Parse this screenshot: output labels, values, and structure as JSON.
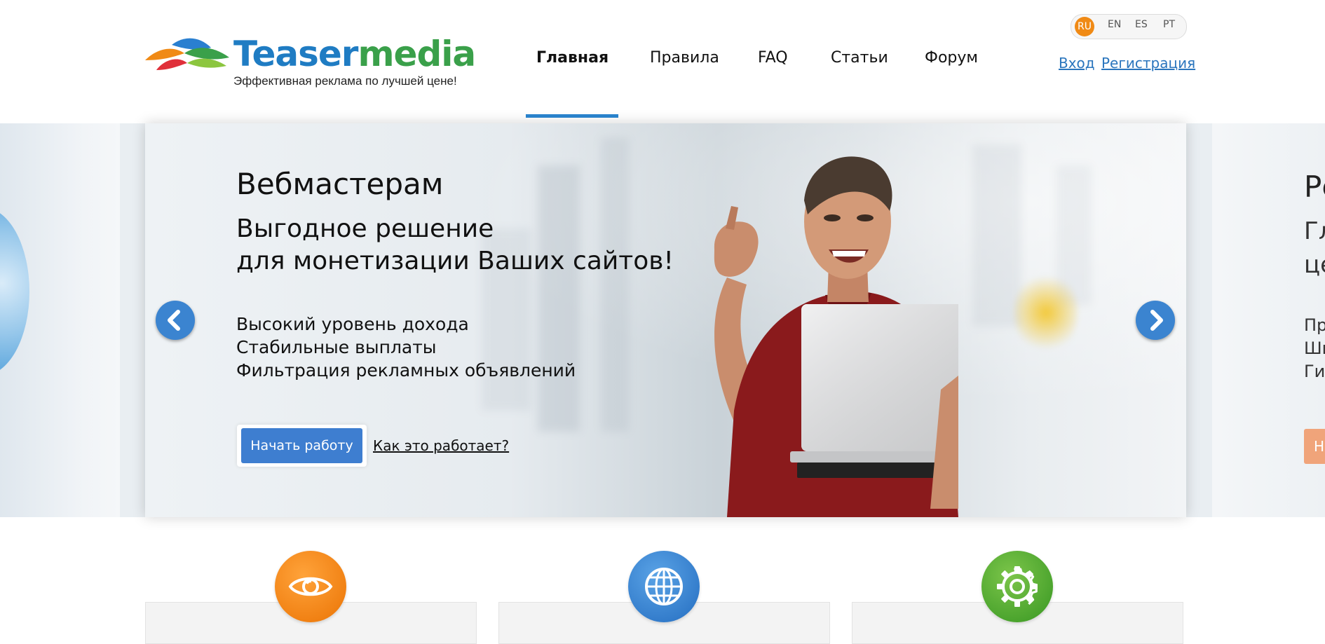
{
  "header": {
    "logo": {
      "word_part1": "Teaser",
      "word_part2": "media",
      "slogan": "Эффективная реклама по лучшей цене!"
    },
    "nav": [
      {
        "label": "Главная",
        "active": true
      },
      {
        "label": "Правила",
        "active": false
      },
      {
        "label": "FAQ",
        "active": false
      },
      {
        "label": "Статьи",
        "active": false
      },
      {
        "label": "Форум",
        "active": false
      }
    ],
    "languages": [
      "RU",
      "EN",
      "ES",
      "PT"
    ],
    "active_language": "RU",
    "auth": {
      "login": "Вход",
      "register": "Регистрация"
    },
    "accent_color": "#2a85d0"
  },
  "slider": {
    "current": {
      "title": "Вебмастерам",
      "subtitle_line1": "Выгодное решение",
      "subtitle_line2": "для монетизации Ваших сайтов!",
      "benefits": [
        "Высокий уровень дохода",
        "Стабильные выплаты",
        "Фильтрация рекламных объявлений"
      ],
      "cta_label": "Начать работу",
      "how_link": "Как это работает?",
      "cta_color": "#3e7ed0"
    },
    "next_peek": {
      "title": "Ре",
      "subtitle_line1": "Гл",
      "subtitle_line2": "це",
      "list": [
        "Пр",
        "Ши",
        "Ги"
      ],
      "cta_label": "Н",
      "cta_color": "#f0a47a"
    },
    "prev_icon": "chevron-left-icon",
    "next_icon": "chevron-right-icon"
  },
  "features": [
    {
      "icon": "eye-icon",
      "color": "#f08a15"
    },
    {
      "icon": "globe-icon",
      "color": "#3b84d0"
    },
    {
      "icon": "gear-icon",
      "color": "#4fa62f"
    }
  ]
}
